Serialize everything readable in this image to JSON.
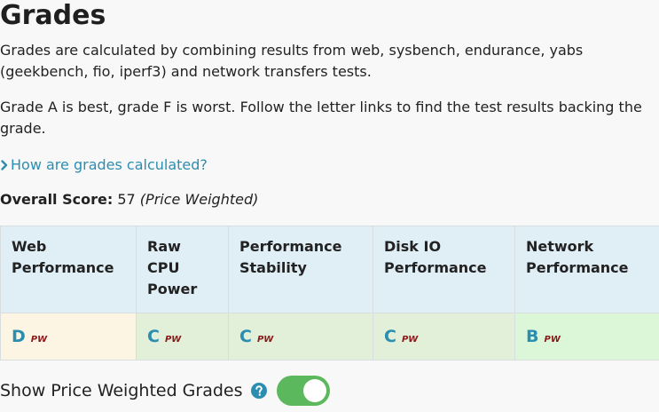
{
  "page": {
    "title": "Grades",
    "intro": "Grades are calculated by combining results from web, sysbench, endurance, yabs (geekbench, fio, iperf3) and network transfers tests.",
    "explanation": "Grade A is best, grade F is worst. Follow the letter links to find the test results backing the grade.",
    "how_link": "How are grades calculated?"
  },
  "overall": {
    "label": "Overall Score:",
    "value": "57",
    "note": "(Price Weighted)"
  },
  "table": {
    "headers": [
      "Web Performance",
      "Raw CPU Power",
      "Performance Stability",
      "Disk IO Performance",
      "Network Performance"
    ],
    "grades": [
      {
        "letter": "D",
        "tag": "PW",
        "bg": "#fdf5e4"
      },
      {
        "letter": "C",
        "tag": "PW",
        "bg": "#e2efd9"
      },
      {
        "letter": "C",
        "tag": "PW",
        "bg": "#e2efd9"
      },
      {
        "letter": "C",
        "tag": "PW",
        "bg": "#e2efd9"
      },
      {
        "letter": "B",
        "tag": "PW",
        "bg": "#dcf7d8"
      }
    ]
  },
  "toggle": {
    "label": "Show Price Weighted Grades",
    "state": "on",
    "help_icon": "question-circle-icon"
  },
  "colors": {
    "link": "#2b8eb0",
    "header_bg": "#e0eef6",
    "toggle_on": "#5cb85c",
    "pw_tag": "#8a1a1a"
  }
}
